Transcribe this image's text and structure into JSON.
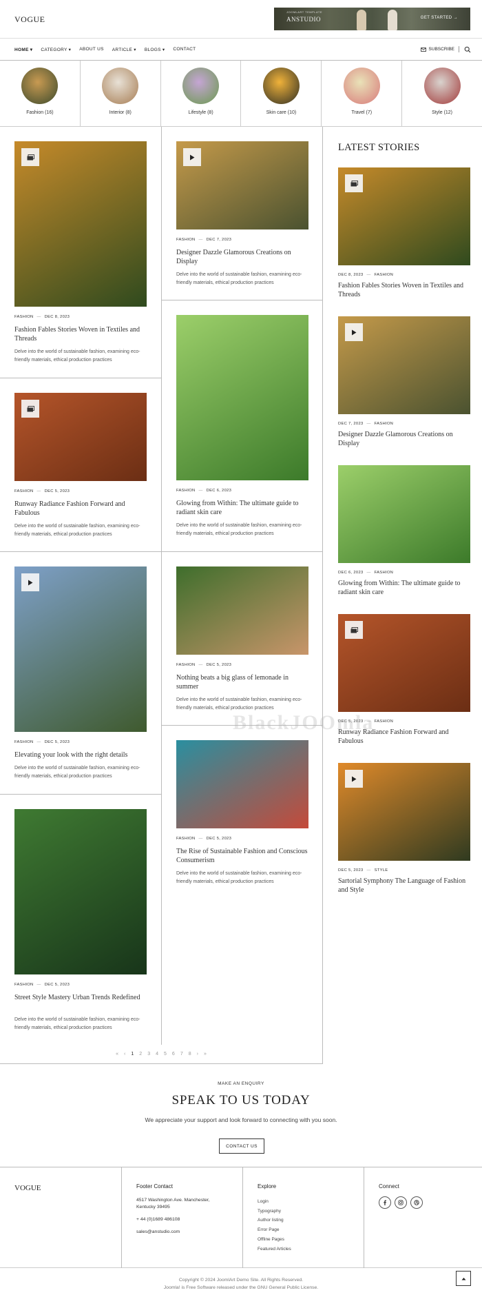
{
  "header": {
    "logo": "VOGUE",
    "banner": {
      "sub": "JOOMLART TEMPLATE",
      "brand": "ANSTUDIO",
      "cta": "GET STARTED →"
    }
  },
  "nav": {
    "items": [
      "HOME ▾",
      "CATEGORY ▾",
      "ABOUT US",
      "ARTICLE ▾",
      "BLOGS ▾",
      "CONTACT"
    ],
    "subscribe": "SUBSCRIBE"
  },
  "categories": [
    {
      "label": "Fashion (16)",
      "colors": [
        "#c89a52",
        "#3b4a2c"
      ]
    },
    {
      "label": "Interior (8)",
      "colors": [
        "#e8e1d6",
        "#a67c52"
      ]
    },
    {
      "label": "Lifestyle (8)",
      "colors": [
        "#c5a5d4",
        "#6a9a4e"
      ]
    },
    {
      "label": "Skin care (10)",
      "colors": [
        "#f0b23a",
        "#2e2e24"
      ]
    },
    {
      "label": "Travel (7)",
      "colors": [
        "#e9e2b8",
        "#d87a7a"
      ]
    },
    {
      "label": "Style (12)",
      "colors": [
        "#d9d3ce",
        "#a23a3a"
      ]
    }
  ],
  "col1": [
    {
      "category": "FASHION",
      "date": "DEC 8, 2023",
      "title": "Fashion Fables Stories Woven in Textiles and Threads",
      "excerpt": "Delve into the world of sustainable fashion, examining eco-friendly materials, ethical production practices",
      "badge": "gallery",
      "colors": [
        "#c68a2a",
        "#2f4a1e"
      ]
    },
    {
      "category": "FASHION",
      "date": "DEC 5, 2023",
      "title": "Runway Radiance Fashion Forward and Fabulous",
      "excerpt": "Delve into the world of sustainable fashion, examining eco-friendly materials, ethical production practices",
      "badge": "gallery",
      "colors": [
        "#b5552a",
        "#6b2e14"
      ]
    },
    {
      "category": "FASHION",
      "date": "DEC 5, 2023",
      "title": "Elevating your look with the right details",
      "excerpt": "Delve into the world of sustainable fashion, examining eco-friendly materials, ethical production practices",
      "badge": "video",
      "colors": [
        "#7ea0c8",
        "#3f5a2e"
      ]
    },
    {
      "category": "FASHION",
      "date": "DEC 5, 2023",
      "title": "Street Style Mastery Urban Trends Redefined",
      "excerpt": "Delve into the world of sustainable fashion, examining eco-friendly materials, ethical production practices",
      "badge": "",
      "colors": [
        "#3f7a32",
        "#18351a"
      ]
    }
  ],
  "col2": [
    {
      "category": "FASHION",
      "date": "DEC 7, 2023",
      "title": "Designer Dazzle Glamorous Creations on Display",
      "excerpt": "Delve into the world of sustainable fashion, examining eco-friendly materials, ethical production practices",
      "badge": "video",
      "colors": [
        "#c59a4a",
        "#4a5230"
      ]
    },
    {
      "category": "FASHION",
      "date": "DEC 6, 2023",
      "title": "Glowing from Within: The ultimate guide to radiant skin care",
      "excerpt": "Delve into the world of sustainable fashion, examining eco-friendly materials, ethical production practices",
      "badge": "",
      "colors": [
        "#9ccf6a",
        "#3c7a2a"
      ]
    },
    {
      "category": "FASHION",
      "date": "DEC 5, 2023",
      "title": "Nothing beats a big glass of lemonade in summer",
      "excerpt": "Delve into the world of sustainable fashion, examining eco-friendly materials, ethical production practices",
      "badge": "",
      "colors": [
        "#3e6e2c",
        "#c8956a"
      ]
    },
    {
      "category": "FASHION",
      "date": "DEC 5, 2023",
      "title": "The Rise of Sustainable Fashion and Conscious Consumerism",
      "excerpt": "Delve into the world of sustainable fashion, examining eco-friendly materials, ethical production practices",
      "badge": "",
      "colors": [
        "#2a8fa0",
        "#c54a3a"
      ]
    }
  ],
  "sidebar": {
    "heading": "LATEST STORIES",
    "items": [
      {
        "date": "DEC 8, 2023",
        "category": "FASHION",
        "title": "Fashion Fables Stories Woven in Textiles and Threads",
        "badge": "gallery",
        "colors": [
          "#c68a2a",
          "#2f4a1e"
        ]
      },
      {
        "date": "DEC 7, 2023",
        "category": "FASHION",
        "title": "Designer Dazzle Glamorous Creations on Display",
        "badge": "video",
        "colors": [
          "#c59a4a",
          "#4a5230"
        ]
      },
      {
        "date": "DEC 6, 2023",
        "category": "FASHION",
        "title": "Glowing from Within: The ultimate guide to radiant skin care",
        "badge": "",
        "colors": [
          "#9ccf6a",
          "#3c7a2a"
        ]
      },
      {
        "date": "DEC 5, 2023",
        "category": "FASHION",
        "title": "Runway Radiance Fashion Forward and Fabulous",
        "badge": "gallery",
        "colors": [
          "#b5552a",
          "#6b2e14"
        ]
      },
      {
        "date": "DEC 5, 2023",
        "category": "STYLE",
        "title": "Sartorial Symphony The Language of Fashion and Style",
        "badge": "video",
        "colors": [
          "#e08a2a",
          "#2f3a20"
        ]
      }
    ]
  },
  "pagination": [
    "«",
    "‹",
    "1",
    "2",
    "3",
    "4",
    "5",
    "6",
    "7",
    "8",
    "›",
    "»"
  ],
  "watermark": "BlackJOOmla",
  "enquiry": {
    "label": "MAKE AN ENQUIRY",
    "title": "SPEAK TO US TODAY",
    "text": "We appreciate your support and look forward to connecting with you soon.",
    "button": "CONTACT US"
  },
  "footer": {
    "logo": "VOGUE",
    "contact": {
      "heading": "Footer Contact",
      "address1": "4517 Washington Ave. Manchester,",
      "address2": "Kentucky 39495",
      "phone": "+ 44 (0)1689 486108",
      "email": "sales@anstudio.com"
    },
    "explore": {
      "heading": "Explore",
      "links": [
        "Login",
        "Typography",
        "Author listing",
        "Error Page",
        "Offline Pages",
        "Featured Articles"
      ]
    },
    "connect": {
      "heading": "Connect",
      "icons": [
        "facebook-icon",
        "instagram-icon",
        "dribbble-icon"
      ]
    },
    "copyright": "Copyright © 2024 JoomlArt Demo Site. All Rights Reserved.",
    "license": "Joomla! is Free Software released under the GNU General Public License."
  },
  "colors": {
    "text": "#222222",
    "border": "#bbbbbb",
    "muted": "#777777"
  }
}
